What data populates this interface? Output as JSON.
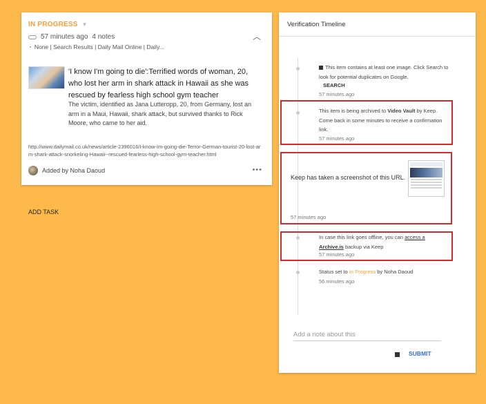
{
  "card": {
    "status": "IN PROGRESS",
    "time_ago": "57 minutes ago",
    "notes_count": "4 notes",
    "source": "None | Search Results | Daily Mail Online | Daily...",
    "title": "'I know I'm going to die':Terrified words of woman, 20, who lost her arm in shark attack in Hawaii as she was rescued by fearless high school gym teacher",
    "description": "The victim, identified as Jana Lutteropp, 20, from Germany, lost an arm in a Maui, Hawaii, shark attack, but survived thanks to Rick Moore, who came to her aid.",
    "url": "http://www.dailymail.co.uk/news/article-2396016/I-know-Im-going-die-Terror-German-tourist-20-lost-arm-shark-attack-snorkeling-Hawaii--rescued-fearless-high-school-gym-teacher.html",
    "added_by": "Added by Noha Daoud"
  },
  "add_task": "ADD TASK",
  "timeline": {
    "title": "Verification Timeline",
    "entry1": {
      "text": "This item contains at least one image. Click Search to look for potential duplicates on Google.",
      "button": "SEARCH",
      "time": "57 minutes ago"
    },
    "entry2": {
      "text_pre": "This item is being archived to ",
      "bold": "Video Vault",
      "text_post": " by Keep. Come back in some minutes to receive a confirmation link.",
      "time": "57 minutes ago"
    },
    "entry3": {
      "text": "Keep has taken a screenshot of this URL.",
      "time": "57 minutes ago"
    },
    "entry4": {
      "text_pre": "In case this link goes offline, you can ",
      "link_a": "access a",
      "link_b": "Archive.is",
      "link_c": " backup via Keep",
      "time": "57 minutes ago"
    },
    "entry5": {
      "text_pre": "Status set to ",
      "status": "In Progress",
      "text_post": " by Noha Daoud",
      "time": "56 minutes ago"
    },
    "note_placeholder": "Add a note about this",
    "submit": "SUBMIT"
  },
  "colors": {
    "background": "#FDB94B",
    "status_orange": "#F2A03D",
    "highlight_red": "#D22B2B",
    "submit_blue": "#3A6FD8"
  }
}
